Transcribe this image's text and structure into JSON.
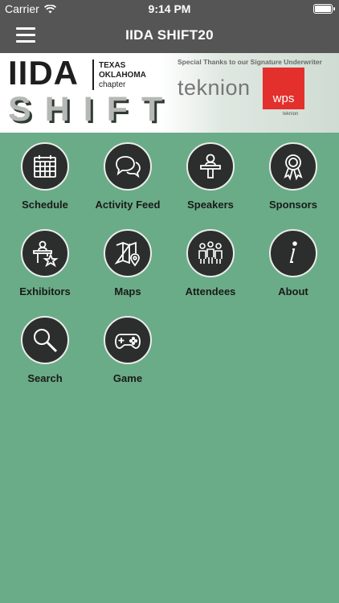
{
  "status_bar": {
    "carrier": "Carrier",
    "time": "9:14 PM"
  },
  "nav": {
    "title": "IIDA SHIFT20",
    "menu_icon": "hamburger-menu-icon"
  },
  "banner": {
    "iida": "IIDA",
    "line1": "TEXAS",
    "line2": "OKLAHOMA",
    "line3": "chapter",
    "shift": "SHIFT",
    "thanks": "Special Thanks to our Signature Underwriter",
    "sponsor": "teknion",
    "wps": "wps",
    "wps_sub": "teknion"
  },
  "colors": {
    "background": "#6aac87",
    "bar": "#555555",
    "tile": "#2b2e2c",
    "accent": "#e3302d"
  },
  "menu": [
    {
      "label": "Schedule",
      "icon": "calendar-icon"
    },
    {
      "label": "Activity Feed",
      "icon": "chat-bubbles-icon"
    },
    {
      "label": "Speakers",
      "icon": "speaker-podium-icon"
    },
    {
      "label": "Sponsors",
      "icon": "award-ribbon-icon"
    },
    {
      "label": "Exhibitors",
      "icon": "exhibitor-star-icon"
    },
    {
      "label": "Maps",
      "icon": "map-pin-icon"
    },
    {
      "label": "Attendees",
      "icon": "people-group-icon"
    },
    {
      "label": "About",
      "icon": "info-icon"
    },
    {
      "label": "Search",
      "icon": "magnifier-icon"
    },
    {
      "label": "Game",
      "icon": "gamepad-icon"
    }
  ]
}
